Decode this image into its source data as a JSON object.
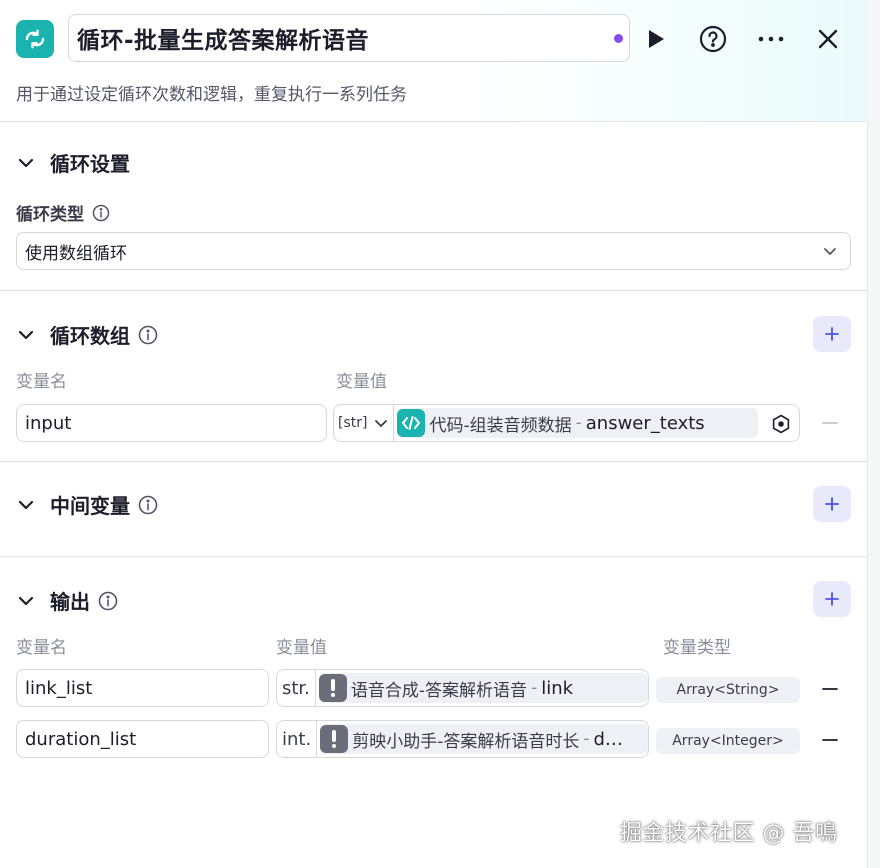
{
  "header": {
    "icon": "loop-icon",
    "title": "循环-批量生成答案解析语音",
    "status_dot_color": "#8a4cf0",
    "description": "用于通过设定循环次数和逻辑，重复执行一系列任务"
  },
  "loop_settings": {
    "title": "循环设置",
    "loop_type_label": "循环类型",
    "loop_type_value": "使用数组循环"
  },
  "loop_array": {
    "title": "循环数组",
    "col_name": "变量名",
    "col_value": "变量值",
    "rows": [
      {
        "name": "input",
        "type_tag": "[str]",
        "source_icon": "code-icon",
        "source": "代码-组装音频数据",
        "sep": "-",
        "variable": "answer_texts"
      }
    ]
  },
  "intermediate": {
    "title": "中间变量"
  },
  "output": {
    "title": "输出",
    "col_name": "变量名",
    "col_value": "变量值",
    "col_type": "变量类型",
    "rows": [
      {
        "name": "link_list",
        "type_tag": "str.",
        "source_icon": "warning-icon",
        "source": "语音合成-答案解析语音",
        "sep": "-",
        "variable": "link",
        "var_type": "Array<String>"
      },
      {
        "name": "duration_list",
        "type_tag": "int.",
        "source_icon": "warning-icon",
        "source": "剪映小助手-答案解析语音时长",
        "sep": "-",
        "variable": "d…",
        "var_type": "Array<Integer>"
      }
    ]
  },
  "watermark": "掘金技术社区 @ 吾鳴",
  "colors": {
    "accent_teal": "#1ab3b0",
    "add_button_bg": "#e8e9fb",
    "add_button_icon": "#4d53e8",
    "warning_icon_bg": "#6b6d7a"
  }
}
